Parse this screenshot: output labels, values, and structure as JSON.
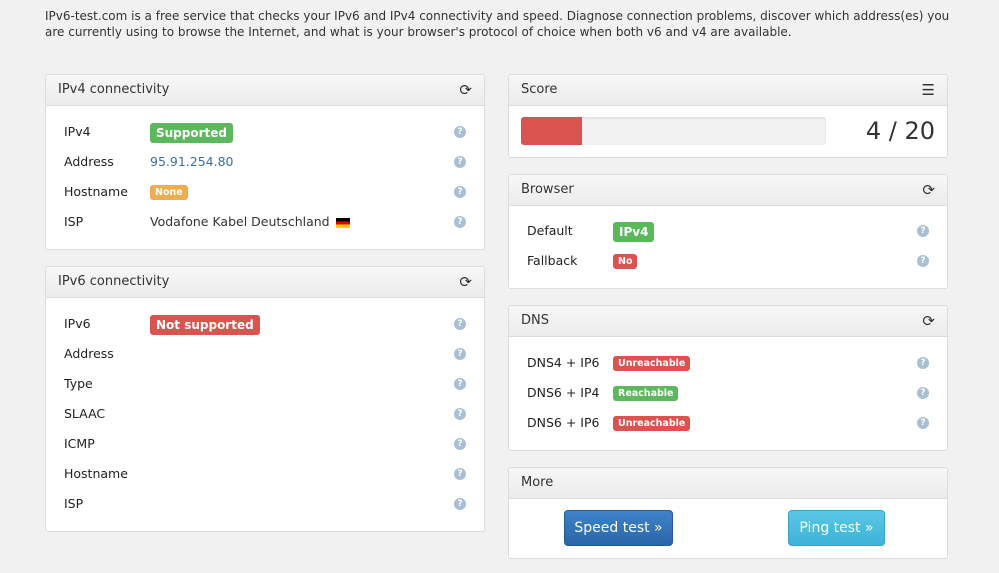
{
  "intro": {
    "text": "IPv6-test.com is a free service that checks your IPv6 and IPv4 connectivity and speed. Diagnose connection problems, discover which address(es) you are currently using to browse the Internet, and what is your browser's protocol of choice when both v6 and v4 are available."
  },
  "ipv4": {
    "title": "IPv4 connectivity",
    "rows": [
      {
        "label": "IPv4",
        "value": "Supported"
      },
      {
        "label": "Address",
        "value": "95.91.254.80"
      },
      {
        "label": "Hostname",
        "value": "None"
      },
      {
        "label": "ISP",
        "value": "Vodafone Kabel Deutschland"
      }
    ]
  },
  "ipv6": {
    "title": "IPv6 connectivity",
    "rows": [
      {
        "label": "IPv6",
        "value": "Not supported"
      },
      {
        "label": "Address"
      },
      {
        "label": "Type"
      },
      {
        "label": "SLAAC"
      },
      {
        "label": "ICMP"
      },
      {
        "label": "Hostname"
      },
      {
        "label": "ISP"
      }
    ]
  },
  "score": {
    "title": "Score",
    "value": 4,
    "max": 20,
    "display": "4 / 20",
    "bar_color": "#d9534f"
  },
  "browser": {
    "title": "Browser",
    "rows": [
      {
        "label": "Default",
        "value": "IPv4"
      },
      {
        "label": "Fallback",
        "value": "No"
      }
    ]
  },
  "dns": {
    "title": "DNS",
    "rows": [
      {
        "label": "DNS4 + IP6",
        "value": "Unreachable"
      },
      {
        "label": "DNS6 + IP4",
        "value": "Reachable"
      },
      {
        "label": "DNS6 + IP6",
        "value": "Unreachable"
      }
    ]
  },
  "more": {
    "title": "More",
    "speed_label": "Speed test »",
    "ping_label": "Ping test »"
  },
  "icons": {
    "refresh": "refresh-icon",
    "list": "list-icon",
    "help": "help-icon",
    "help_glyph": "?",
    "refresh_glyph": "⟳",
    "list_glyph": "☰"
  },
  "colors": {
    "success": "#5cb85c",
    "danger": "#d9534f",
    "warning": "#f0ad4e",
    "link": "#3a6ea5"
  }
}
